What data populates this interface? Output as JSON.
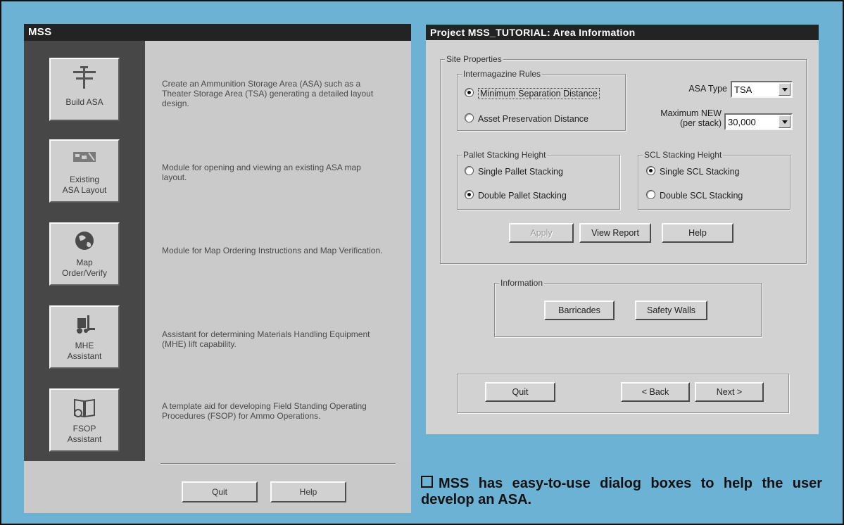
{
  "mss_window": {
    "title": "MSS",
    "modules": [
      {
        "id": "build-asa",
        "label": "Build ASA",
        "icon": "build-asa-icon",
        "description": "Create an Ammunition Storage Area (ASA) such as a Theater Storage Area (TSA) generating a detailed layout design."
      },
      {
        "id": "existing-asa-layout",
        "label": "Existing ASA Layout",
        "icon": "map-layout-icon",
        "description": "Module for opening and viewing an existing ASA map layout."
      },
      {
        "id": "map-order-verify",
        "label": "Map Order/Verify",
        "icon": "globe-icon",
        "description": "Module for Map Ordering Instructions and Map Verification."
      },
      {
        "id": "mhe-assistant",
        "label": "MHE Assistant",
        "icon": "forklift-icon",
        "description": "Assistant for determining Materials Handling Equipment (MHE) lift capability."
      },
      {
        "id": "fsop-assistant",
        "label": "FSOP Assistant",
        "icon": "book-icon",
        "description": "A template aid for developing Field Standing Operating Procedures (FSOP) for Ammo Operations."
      }
    ],
    "quit_label": "Quit",
    "help_label": "Help"
  },
  "area_dialog": {
    "title": "Project MSS_TUTORIAL: Area Information",
    "site_properties_label": "Site Properties",
    "intermagazine": {
      "label": "Intermagazine Rules",
      "options": [
        "Minimum Separation Distance",
        "Asset Preservation Distance"
      ],
      "selected": "Minimum Separation Distance"
    },
    "asa_type": {
      "label": "ASA Type",
      "value": "TSA"
    },
    "maximum_new": {
      "label_line1": "Maximum NEW",
      "label_line2": "(per stack)",
      "value": "30,000"
    },
    "pallet_stacking": {
      "label": "Pallet Stacking Height",
      "options": [
        "Single Pallet Stacking",
        "Double Pallet Stacking"
      ],
      "selected": "Double Pallet Stacking"
    },
    "scl_stacking": {
      "label": "SCL Stacking Height",
      "options": [
        "Single SCL Stacking",
        "Double SCL Stacking"
      ],
      "selected": "Single SCL Stacking"
    },
    "apply_label": "Apply",
    "view_report_label": "View Report",
    "help_label": "Help",
    "information": {
      "label": "Information",
      "barricades_label": "Barricades",
      "safety_walls_label": "Safety Walls"
    },
    "quit_label": "Quit",
    "back_label": "< Back",
    "next_label": "Next >"
  },
  "caption": "MSS has easy-to-use dialog boxes to help the user develop an ASA.",
  "colors": {
    "background": "#6cb2d5",
    "titlebar": "#232323",
    "sidebar": "#474747",
    "window": "#cacaca"
  }
}
